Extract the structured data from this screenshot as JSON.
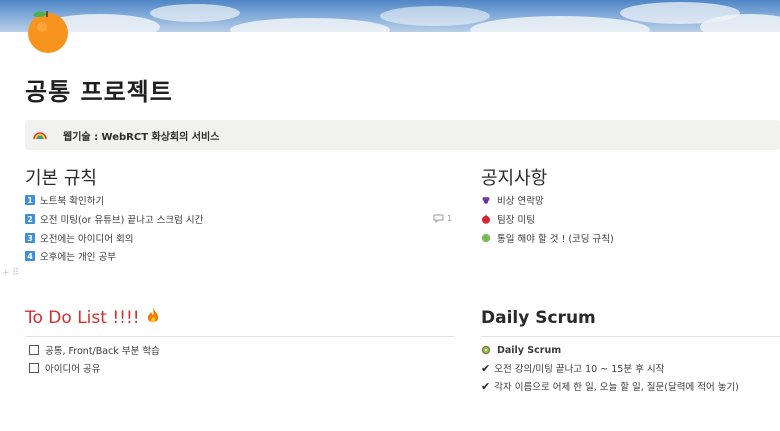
{
  "page": {
    "title": "공통 프로젝트",
    "icon": "orange-emoji-icon"
  },
  "callout": {
    "icon": "rainbow-icon",
    "text": "웹기술 : WebRCT 화상회의 서비스"
  },
  "basic_rules": {
    "heading": "기본 규칙",
    "items": [
      {
        "num": "1",
        "text": "노트북 확인하기"
      },
      {
        "num": "2",
        "text": "오전 미팅(or 유튜브) 끝나고 스크럼 시간"
      },
      {
        "num": "3",
        "text": "오전에는 아이디어 회의"
      },
      {
        "num": "4",
        "text": "오후에는 개인 공부"
      }
    ],
    "comment_count": "1"
  },
  "notices": {
    "heading": "공지사항",
    "items": [
      {
        "icon": "grape-icon",
        "color": "#7b3fb0",
        "text": "비상 연락망"
      },
      {
        "icon": "apple-icon",
        "color": "#d9262d",
        "text": "팀장 미팅"
      },
      {
        "icon": "melon-icon",
        "color": "#7cc35a",
        "text": "통일 해야 할 것 ! (코딩 규칙)"
      }
    ]
  },
  "todo": {
    "heading": "To Do List !!!!",
    "heading_icon": "fire-icon",
    "heading_color": "#d1312b",
    "items": [
      {
        "text": "공통, Front/Back 부분 학습"
      },
      {
        "text": "아이디어 공유"
      }
    ]
  },
  "scrum": {
    "heading": "Daily Scrum",
    "items": [
      {
        "icon": "kiwi-icon",
        "text": "Daily Scrum"
      },
      {
        "icon": "check-icon",
        "text": "오전 강의/미팅 끝나고 10 ~ 15분 후 시작"
      },
      {
        "icon": "check-icon",
        "text": "각자 이름으로 어제 한 일, 오늘 할 일, 질문(달력에 적어 놓기)"
      }
    ]
  }
}
